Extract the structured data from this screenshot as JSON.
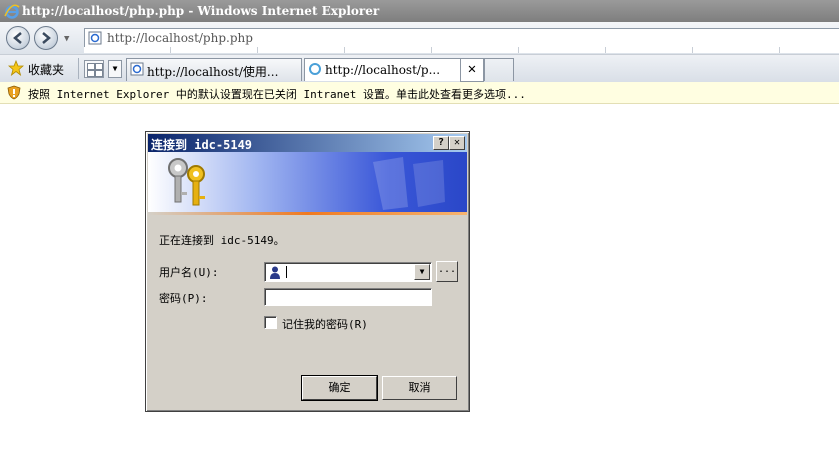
{
  "window": {
    "title": "http://localhost/php.php - Windows Internet Explorer"
  },
  "address_bar": {
    "url": "http://localhost/php.php"
  },
  "favorites": {
    "label": "收藏夹"
  },
  "tabs": [
    {
      "label": "http://localhost/使用...",
      "active": false
    },
    {
      "label": "http://localhost/p...",
      "active": true
    }
  ],
  "info_bar": {
    "message": "按照 Internet Explorer 中的默认设置现在已关闭 Intranet 设置。单击此处查看更多选项..."
  },
  "dialog": {
    "title": "连接到 idc-5149",
    "help_button": "?",
    "close_button": "✕",
    "connecting_text": "正在连接到 idc-5149。",
    "username_label": "用户名(U):",
    "username_value": "",
    "browse_button": "...",
    "password_label": "密码(P):",
    "password_value": "",
    "remember_label": "记住我的密码(R)",
    "remember_checked": false,
    "ok_button": "确定",
    "cancel_button": "取消"
  },
  "colors": {
    "title_gradient_start": "#0a246a",
    "title_gradient_end": "#a6caf0",
    "dialog_face": "#d4d0c8",
    "info_bar": "#fffee1"
  }
}
